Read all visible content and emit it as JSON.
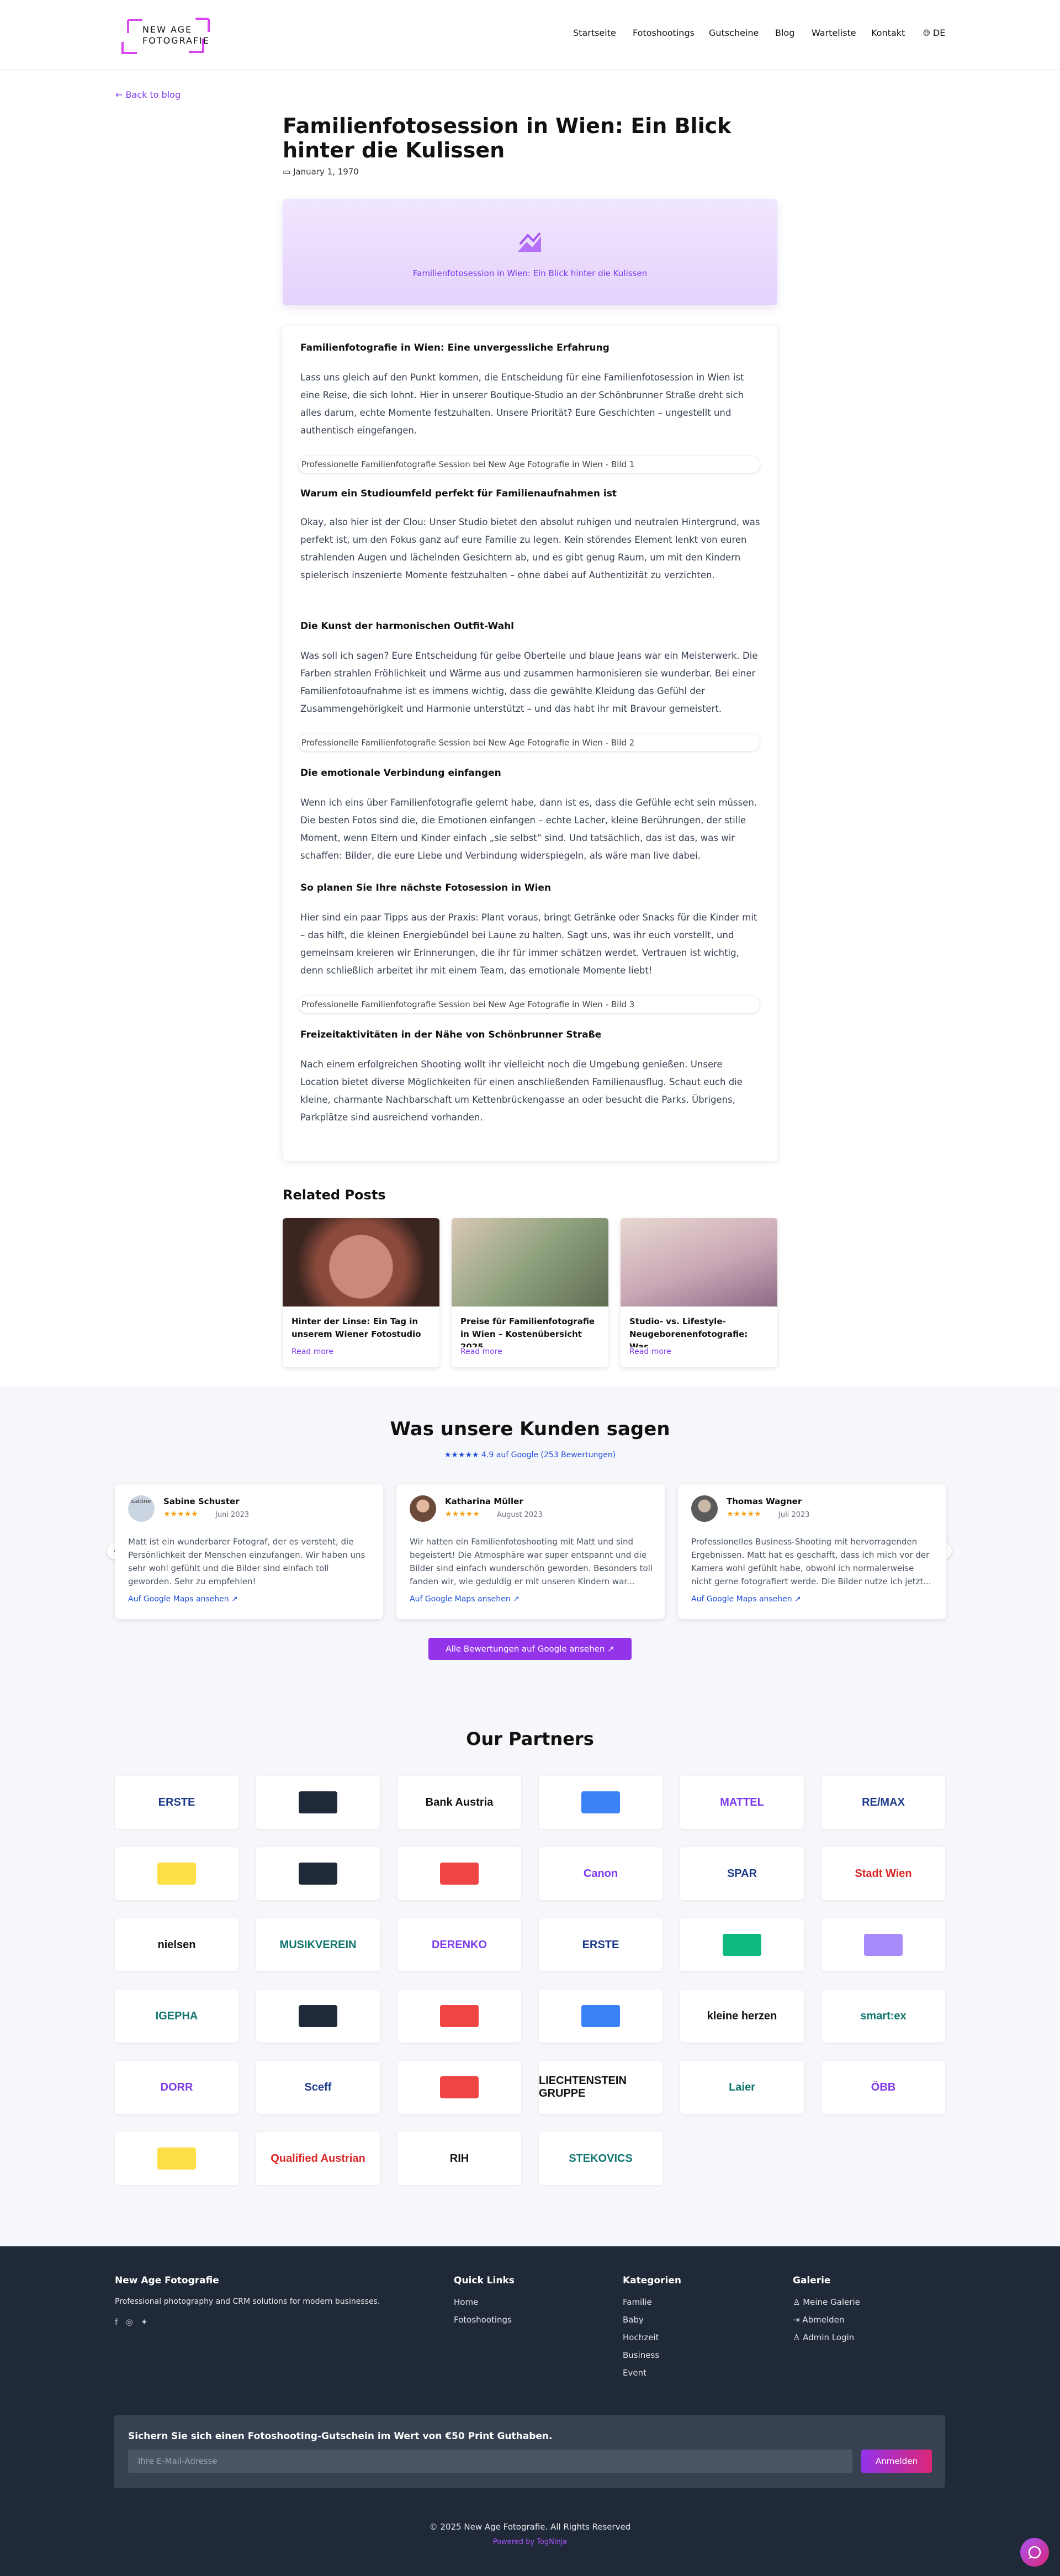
{
  "header": {
    "logo_line1": "NEW AGE",
    "logo_line2": "FOTOGRAFIE",
    "nav": [
      "Startseite",
      "Fotoshootings",
      "Gutscheine",
      "Blog",
      "Warteliste",
      "Kontakt"
    ],
    "lang": "DE"
  },
  "post": {
    "back": "Back to blog",
    "title": "Familienfotosession in Wien: Ein Blick hinter die Kulissen",
    "date": "January 1, 1970",
    "hero_caption": "Familienfotosession in Wien: Ein Blick hinter die Kulissen"
  },
  "article": {
    "h1": "Familienfotografie in Wien: Eine unvergessliche Erfahrung",
    "p1": "Lass uns gleich auf den Punkt kommen, die Entscheidung für eine Familienfotosession in Wien ist eine Reise, die sich lohnt. Hier in unserer Boutique-Studio an der Schönbrunner Straße dreht sich alles darum, echte Momente festzuhalten. Unsere Priorität? Eure Geschichten – ungestellt und authentisch eingefangen.",
    "img1": "Professionelle Familienfotografie Session bei New Age Fotografie in Wien - Bild 1",
    "h2": "Warum ein Studioumfeld perfekt für Familienaufnahmen ist",
    "p2": "Okay, also hier ist der Clou: Unser Studio bietet den absolut ruhigen und neutralen Hintergrund, was perfekt ist, um den Fokus ganz auf eure Familie zu legen. Kein störendes Element lenkt von euren strahlenden Augen und lächelnden Gesichtern ab, und es gibt genug Raum, um mit den Kindern spielerisch inszenierte Momente festzuhalten – ohne dabei auf Authentizität zu verzichten.",
    "h3": "Die Kunst der harmonischen Outfit-Wahl",
    "p3": "Was soll ich sagen? Eure Entscheidung für gelbe Oberteile und blaue Jeans war ein Meisterwerk. Die Farben strahlen Fröhlichkeit und Wärme aus und zusammen harmonisieren sie wunderbar. Bei einer Familienfotoaufnahme ist es immens wichtig, dass die gewählte Kleidung das Gefühl der Zusammengehörigkeit und Harmonie unterstützt – und das habt ihr mit Bravour gemeistert.",
    "img2": "Professionelle Familienfotografie Session bei New Age Fotografie in Wien - Bild 2",
    "h4": "Die emotionale Verbindung einfangen",
    "p4": "Wenn ich eins über Familienfotografie gelernt habe, dann ist es, dass die Gefühle echt sein müssen. Die besten Fotos sind die, die Emotionen einfangen – echte Lacher, kleine Berührungen, der stille Moment, wenn Eltern und Kinder einfach „sie selbst“ sind. Und tatsächlich, das ist das, was wir schaffen: Bilder, die eure Liebe und Verbindung widerspiegeln, als wäre man live dabei.",
    "h5": "So planen Sie Ihre nächste Fotosession in Wien",
    "p5": "Hier sind ein paar Tipps aus der Praxis: Plant voraus, bringt Getränke oder Snacks für die Kinder mit – das hilft, die kleinen Energiebündel bei Laune zu halten. Sagt uns, was ihr euch vorstellt, und gemeinsam kreieren wir Erinnerungen, die ihr für immer schätzen werdet. Vertrauen ist wichtig, denn schließlich arbeitet ihr mit einem Team, das emotionale Momente liebt!",
    "img3": "Professionelle Familienfotografie Session bei New Age Fotografie in Wien - Bild 3",
    "h6": "Freizeitaktivitäten in der Nähe von Schönbrunner Straße",
    "p6": "Nach einem erfolgreichen Shooting wollt ihr vielleicht noch die Umgebung genießen. Unsere Location bietet diverse Möglichkeiten für einen anschließenden Familienausflug. Schaut euch die kleine, charmante Nachbarschaft um Kettenbrückengasse an oder besucht die Parks. Übrigens, Parkplätze sind ausreichend vorhanden."
  },
  "related": {
    "title": "Related Posts",
    "read_more": "Read more",
    "posts": [
      {
        "title": "Hinter der Linse: Ein Tag in unserem Wiener Fotostudio"
      },
      {
        "title": "Preise für Familienfotografie in Wien – Kostenübersicht 2025"
      },
      {
        "title": "Studio- vs. Lifestyle-Neugeborenenfotografie: Was..."
      }
    ]
  },
  "reviews": {
    "title": "Was unsere Kunden sagen",
    "summary": "★★★★★ 4.9 auf Google (253 Bewertungen)",
    "link": "Auf Google Maps ansehen ↗",
    "button": "Alle Bewertungen auf Google ansehen ↗",
    "items": [
      {
        "name": "Sabine Schuster",
        "stars": "★★★★★",
        "date": "Juni 2023",
        "avatar_alt": "Sabine",
        "text": "Matt ist ein wunderbarer Fotograf, der es versteht, die Persönlichkeit der Menschen einzufangen. Wir haben uns sehr wohl gefühlt und die Bilder sind einfach toll geworden. Sehr zu empfehlen!"
      },
      {
        "name": "Katharina Müller",
        "stars": "★★★★★",
        "date": "August 2023",
        "text": "Wir hatten ein Familienfotoshooting mit Matt und sind begeistert! Die Atmosphäre war super entspannt und die Bilder sind einfach wunderschön geworden. Besonders toll fanden wir, wie geduldig er mit unseren Kindern war..."
      },
      {
        "name": "Thomas Wagner",
        "stars": "★★★★★",
        "date": "Juli 2023",
        "text": "Professionelles Business-Shooting mit hervorragenden Ergebnissen. Matt hat es geschafft, dass ich mich vor der Kamera wohl gefühlt habe, obwohl ich normalerweise nicht gerne fotografiert werde. Die Bilder nutze ich jetzt..."
      }
    ]
  },
  "partners": {
    "title": "Our Partners",
    "logos": [
      "ERSTE",
      "Bank Austria",
      "MATTEL",
      "RE/MAX",
      "Canon",
      "SPAR",
      "Stadt Wien",
      "nielsen",
      "MUSIKVEREIN",
      "DERENKO",
      "ERSTE",
      "IGEPHA",
      "kleine herzen",
      "smart:ex",
      "DORR",
      "Sceff",
      "LIECHTENSTEIN GRUPPE",
      "Laier",
      "ÖBB",
      "Qualified Austrian",
      "RIH",
      "STEKOVICS"
    ]
  },
  "footer": {
    "brand": "New Age Fotografie",
    "tagline": "Professional photography and CRM solutions for modern businesses.",
    "quick": {
      "title": "Quick Links",
      "items": [
        "Home",
        "Fotoshootings"
      ]
    },
    "cat": {
      "title": "Kategorien",
      "items": [
        "Familie",
        "Baby",
        "Hochzeit",
        "Business",
        "Event"
      ]
    },
    "gal": {
      "title": "Galerie",
      "items": [
        "Meine Galerie",
        "Abmelden",
        "Admin Login"
      ]
    },
    "newsletter": {
      "title": "Sichern Sie sich einen Fotoshooting-Gutschein im Wert von €50 Print Guthaben.",
      "placeholder": "Ihre E-Mail-Adresse",
      "button": "Anmelden"
    },
    "copyright": "© 2025 New Age Fotografie. All Rights Reserved",
    "powered": "Powered by TogNinja"
  }
}
